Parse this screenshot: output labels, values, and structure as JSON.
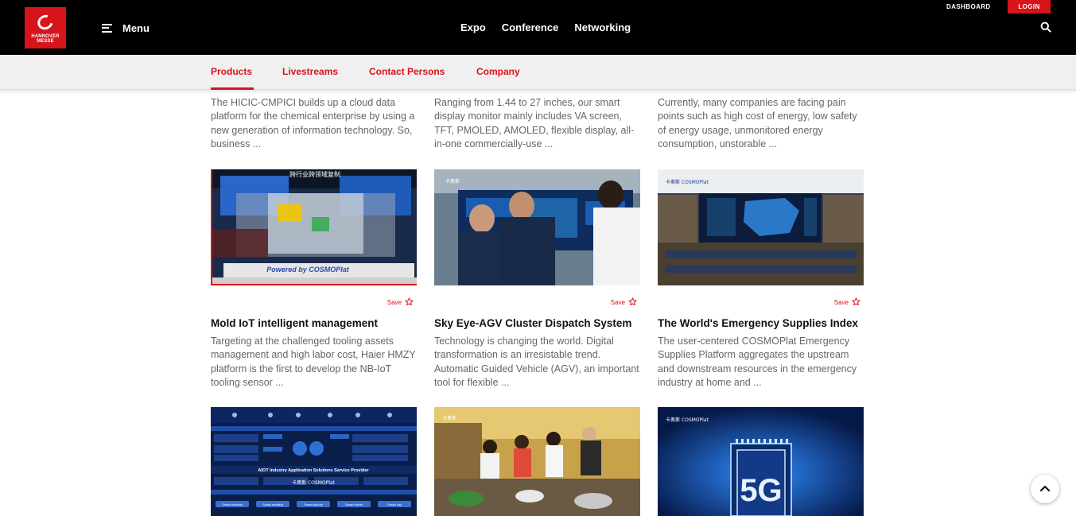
{
  "header": {
    "logo_line1": "HANNOVER",
    "logo_line2": "MESSE",
    "menu_label": "Menu",
    "nav": [
      "Expo",
      "Conference",
      "Networking"
    ],
    "dashboard": "DASHBOARD",
    "login": "LOGIN",
    "accent": "#d7141a"
  },
  "subnav": {
    "tabs": [
      "Products",
      "Livestreams",
      "Contact Persons",
      "Company"
    ],
    "active": "Products"
  },
  "top_descriptions": [
    "The HICIC-CMPICI builds up a cloud data platform for the chemical enterprise by using a new generation of information technology. So, business ...",
    "Ranging from 1.44 to 27 inches, our smart display monitor mainly includes VA screen, TFT, PMOLED, AMOLED, flexible display, all-in-one commercially-use ...",
    "Currently, many companies are facing pain points such as high cost of energy, low safety of energy usage, unmonitored energy consumption, unstorable ..."
  ],
  "products": [
    {
      "save": "Save",
      "title": "Mold IoT intelligent management",
      "description": "Targeting at the challenged tooling assets management and high labor cost, Haier HMZY platform is the first to develop the NB-IoT tooling sensor ...",
      "image_banner": "跨行业跨领域复制",
      "image_caption": "Powered by COSMOPlat"
    },
    {
      "save": "Save",
      "title": "Sky Eye-AGV Cluster Dispatch System",
      "description": "Technology is changing the world. Digital transformation is an irresistable trend. Automatic Guided Vehicle (AGV), an important tool for flexible ...",
      "image_brand": "卡奥斯"
    },
    {
      "save": "Save",
      "title": "The World's Emergency Supplies Index",
      "description": "The user-centered COSMOPlat Emergency Supplies Platform aggregates the upstream and downstream resources in the emergency industry at home and ...",
      "image_brand": "卡奥斯 COSMOPlat"
    }
  ],
  "bottom_images": [
    {
      "brand": "卡奥斯 COSMOPlat",
      "heading": "AIOT Industry Application Solutions Service Provider",
      "chips": [
        "Smart medical",
        "Smart retailing",
        "Smart factory",
        "Smart home",
        "Smart city"
      ]
    },
    {
      "brand": "卡奥斯"
    },
    {
      "brand": "卡奥斯 COSMOPlat",
      "chip_label": "5G"
    }
  ]
}
